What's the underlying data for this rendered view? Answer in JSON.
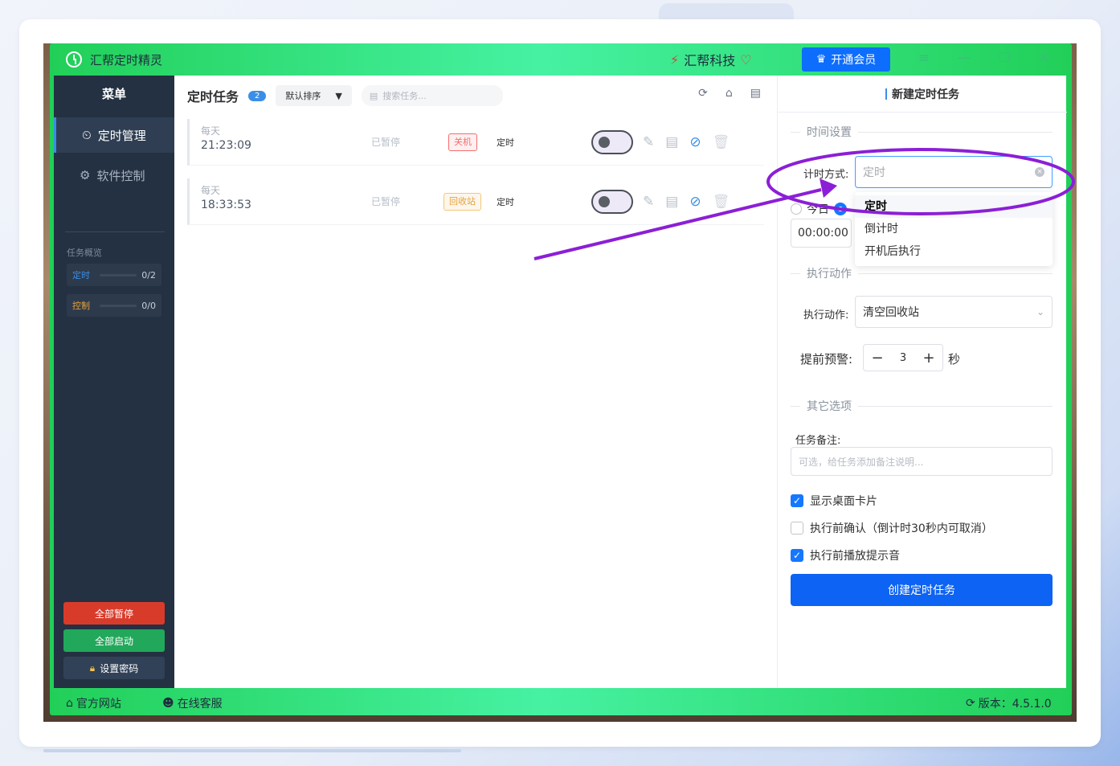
{
  "window": {
    "title": "汇帮定时精灵",
    "brand": "汇帮科技",
    "vip_label": "开通会员",
    "controls": [
      "≡",
      "—",
      "☐",
      "✕"
    ]
  },
  "sidebar": {
    "menu_title": "菜单",
    "items": [
      {
        "label": "定时管理",
        "icon": "clock-icon",
        "active": true
      },
      {
        "label": "软件控制",
        "icon": "gear-icon",
        "active": false
      }
    ],
    "overview_title": "任务概览",
    "stats": [
      {
        "label": "定时",
        "value": "0/2",
        "color": "#3a8ee6"
      },
      {
        "label": "控制",
        "value": "0/0",
        "color": "#e6a23c"
      }
    ],
    "buttons": {
      "pause_all": "全部暂停",
      "start_all": "全部启动",
      "set_password": "设置密码"
    },
    "colors": {
      "pause": "#d93b2b",
      "start": "#22a85a",
      "password": "#314157"
    }
  },
  "task_list": {
    "title": "定时任务",
    "count": "2",
    "sort_label": "默认排序",
    "search_placeholder": "搜索任务...",
    "tasks": [
      {
        "frequency": "每天",
        "time": "21:23:09",
        "status": "已暂停",
        "action_tag": "关机",
        "tag_color": "red",
        "mode": "定时",
        "enabled": false
      },
      {
        "frequency": "每天",
        "time": "18:33:53",
        "status": "已暂停",
        "action_tag": "回收站",
        "tag_color": "yellow",
        "mode": "定时",
        "enabled": false
      }
    ]
  },
  "new_task": {
    "title": "新建定时任务",
    "section_time": "时间设置",
    "timing_label": "计时方式:",
    "timing_value": "定时",
    "today_label": "今日",
    "time_value": "00:00:00",
    "dropdown_options": [
      "定时",
      "倒计时",
      "开机后执行"
    ],
    "dropdown_selected": "定时",
    "section_action": "执行动作",
    "action_label": "执行动作:",
    "action_value": "清空回收站",
    "warn_label": "提前预警:",
    "warn_value": "3",
    "warn_unit": "秒",
    "section_other": "其它选项",
    "note_label": "任务备注:",
    "note_placeholder": "可选，给任务添加备注说明...",
    "options": [
      {
        "label": "显示桌面卡片",
        "checked": true
      },
      {
        "label": "执行前确认（倒计时30秒内可取消）",
        "checked": false
      },
      {
        "label": "执行前播放提示音",
        "checked": true
      }
    ],
    "create_button": "创建定时任务"
  },
  "statusbar": {
    "website": "官方网站",
    "support": "在线客服",
    "version": "版本：4.5.1.0"
  },
  "annotation_color": "#8b1fd6"
}
